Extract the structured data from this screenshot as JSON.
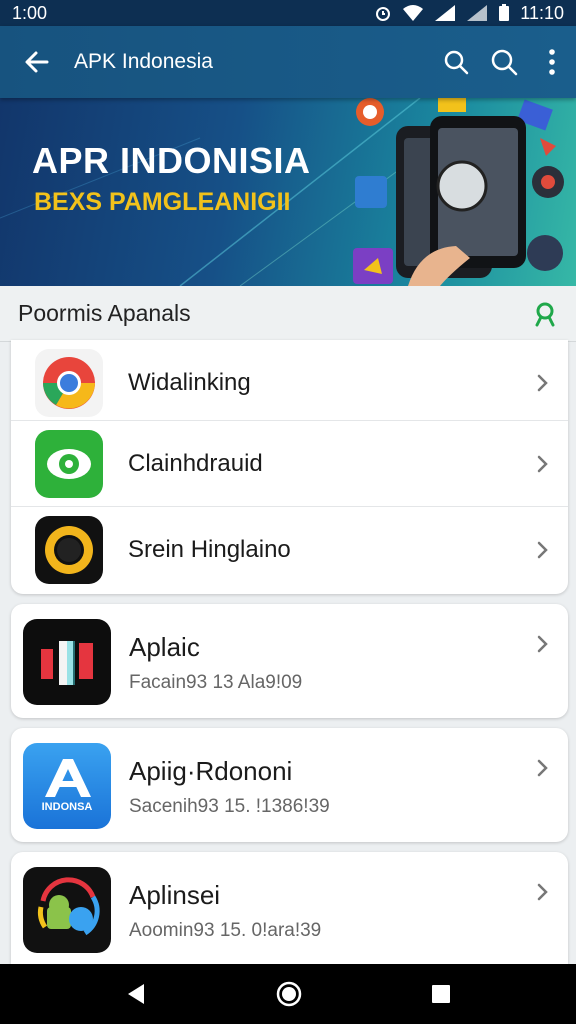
{
  "status_bar": {
    "time_left": "1:00",
    "time_right": "11:10"
  },
  "app_bar": {
    "title": "APK Indonesia"
  },
  "banner": {
    "title": "APR INDONISIA",
    "subtitle": "BEXS PAMGLEANIGII"
  },
  "section": {
    "title": "Poormis  Apanals"
  },
  "list_group": [
    {
      "label": "Widalinking",
      "icon": "chrome-style-icon"
    },
    {
      "label": "Clainhdrauid",
      "icon": "green-eye-icon"
    },
    {
      "label": "Srein Hinglaino",
      "icon": "sun-gear-icon"
    }
  ],
  "app_cards": [
    {
      "name": "Aplaic",
      "sub": "Facain93  13  Ala9!09",
      "icon": "tiktok-style-icon"
    },
    {
      "name": "Apiig·Rdononi",
      "sub": "Sacenih93  15.  !1386!39",
      "icon": "a-logo-icon",
      "icon_text": "INDONSA"
    },
    {
      "name": "Aplinsei",
      "sub": "Aoomin93  15.  0!ara!39",
      "icon": "android-swirl-icon"
    }
  ],
  "colors": {
    "app_bar": "#17537f",
    "status_bar": "#0d2f52",
    "accent_green": "#1fa84a",
    "banner_yellow": "#f2c21b"
  }
}
